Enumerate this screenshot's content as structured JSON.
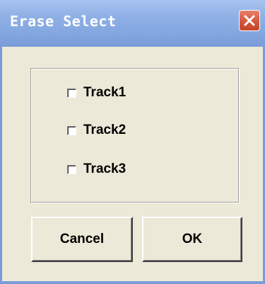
{
  "window": {
    "title": "Erase Select"
  },
  "tracks": [
    {
      "label": "Track1",
      "checked": false
    },
    {
      "label": "Track2",
      "checked": false
    },
    {
      "label": "Track3",
      "checked": false
    }
  ],
  "buttons": {
    "cancel_label": "Cancel",
    "ok_label": "OK"
  },
  "icons": {
    "close": "close-icon"
  },
  "colors": {
    "titlebar": "#84a7e0",
    "title_text": "#ffffff",
    "dialog_bg": "#ece9d8",
    "close_button": "#d4573b"
  }
}
